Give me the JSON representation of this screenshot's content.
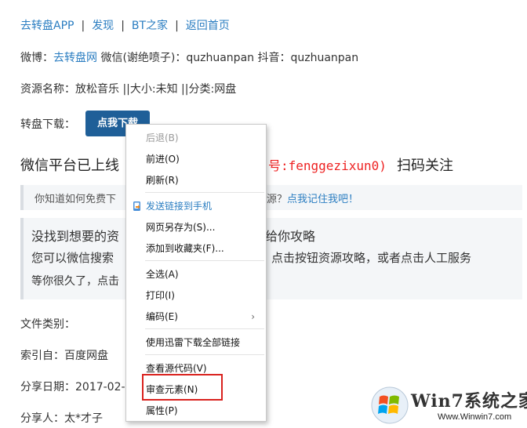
{
  "nav": {
    "items": [
      "去转盘APP",
      "发现",
      "BT之家",
      "返回首页"
    ],
    "separator": "|"
  },
  "social": {
    "weibo_label": "微博：",
    "weibo_link": "去转盘网",
    "rest": " 微信(谢绝喷子)：quzhuanpan 抖音：quzhuanpan"
  },
  "resource": {
    "line": "资源名称：放松音乐 ||大小:未知 ||分类:网盘"
  },
  "download": {
    "label": "转盘下载：",
    "button": "点我下载"
  },
  "wechat": {
    "left": "微信平台已上线",
    "red": "号:fenggezixun0)",
    "tail": "扫码关注"
  },
  "tip": {
    "left": "你知道如何免费下",
    "right_plain": "源？",
    "right_link": "点我记住我吧！"
  },
  "info": {
    "line1_left": "没找到想要的资",
    "line1_right": "给你攻略",
    "line2_left": "您可以微信搜索",
    "line2_right": "点击按钮资源攻略，或者点击人工服务",
    "line3": "等你很久了，点击"
  },
  "details": {
    "file_type": "文件类别：",
    "index": "索引自：百度网盘",
    "share_date": "分享日期：2017-02-",
    "sharer": "分享人：太*才子"
  },
  "context_menu": {
    "back": "后退(B)",
    "forward": "前进(O)",
    "refresh": "刷新(R)",
    "send_link": "发送链接到手机",
    "save_as": "网页另存为(S)...",
    "add_favorite": "添加到收藏夹(F)...",
    "select_all": "全选(A)",
    "print": "打印(I)",
    "encoding": "编码(E)",
    "submenu_arrow": "›",
    "xunlei": "使用迅雷下载全部链接",
    "view_source": "查看源代码(V)",
    "inspect": "审查元素(N)",
    "properties": "属性(P)"
  },
  "watermark": {
    "brand": "Win7系统之家",
    "url": "Www.Winwin7.com"
  },
  "colors": {
    "link": "#2a7dc1",
    "button_bg": "#1f5f98",
    "highlight": "#d9221e",
    "red_text": "#e22222"
  }
}
